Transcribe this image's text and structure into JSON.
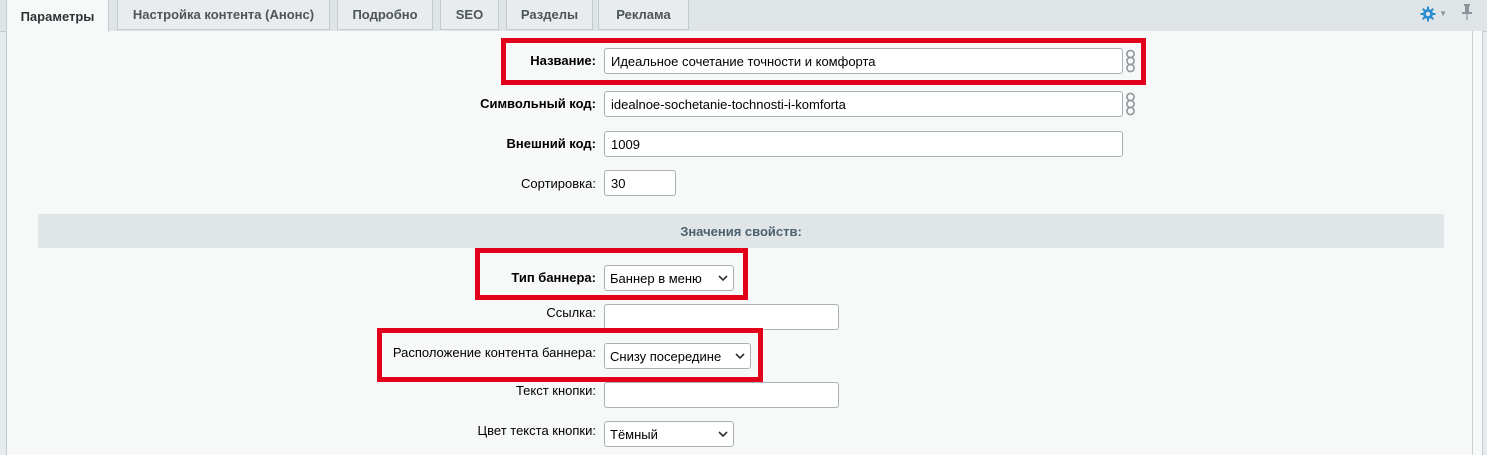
{
  "tabs": [
    {
      "label": "Параметры",
      "active": true
    },
    {
      "label": "Настройка контента (Анонс)",
      "active": false
    },
    {
      "label": "Подробно",
      "active": false
    },
    {
      "label": "SEO",
      "active": false
    },
    {
      "label": "Разделы",
      "active": false
    },
    {
      "label": "Реклама",
      "active": false
    }
  ],
  "toolbar": {
    "settings_icon": "gear-icon",
    "pin_icon": "pin-icon"
  },
  "fields": {
    "name": {
      "label": "Название:",
      "value": "Идеальное сочетание точности и комфорта"
    },
    "code": {
      "label": "Символьный код:",
      "value": "idealnoe-sochetanie-tochnosti-i-komforta"
    },
    "xml_id": {
      "label": "Внешний код:",
      "value": "1009"
    },
    "sort": {
      "label": "Сортировка:",
      "value": "30"
    }
  },
  "properties": {
    "header": "Значения свойств:",
    "banner_type": {
      "label": "Тип баннера:",
      "value": "Баннер в меню"
    },
    "link": {
      "label": "Ссылка:",
      "value": ""
    },
    "content_position": {
      "label": "Расположение контента баннера:",
      "value": "Снизу посередине"
    },
    "button_text": {
      "label": "Текст кнопки:",
      "value": ""
    },
    "button_text_color": {
      "label": "Цвет текста кнопки:",
      "value": "Тёмный"
    }
  },
  "colors": {
    "highlight": "#e3001b",
    "accent": "#2a8bd2",
    "section_text": "#4b6170"
  }
}
